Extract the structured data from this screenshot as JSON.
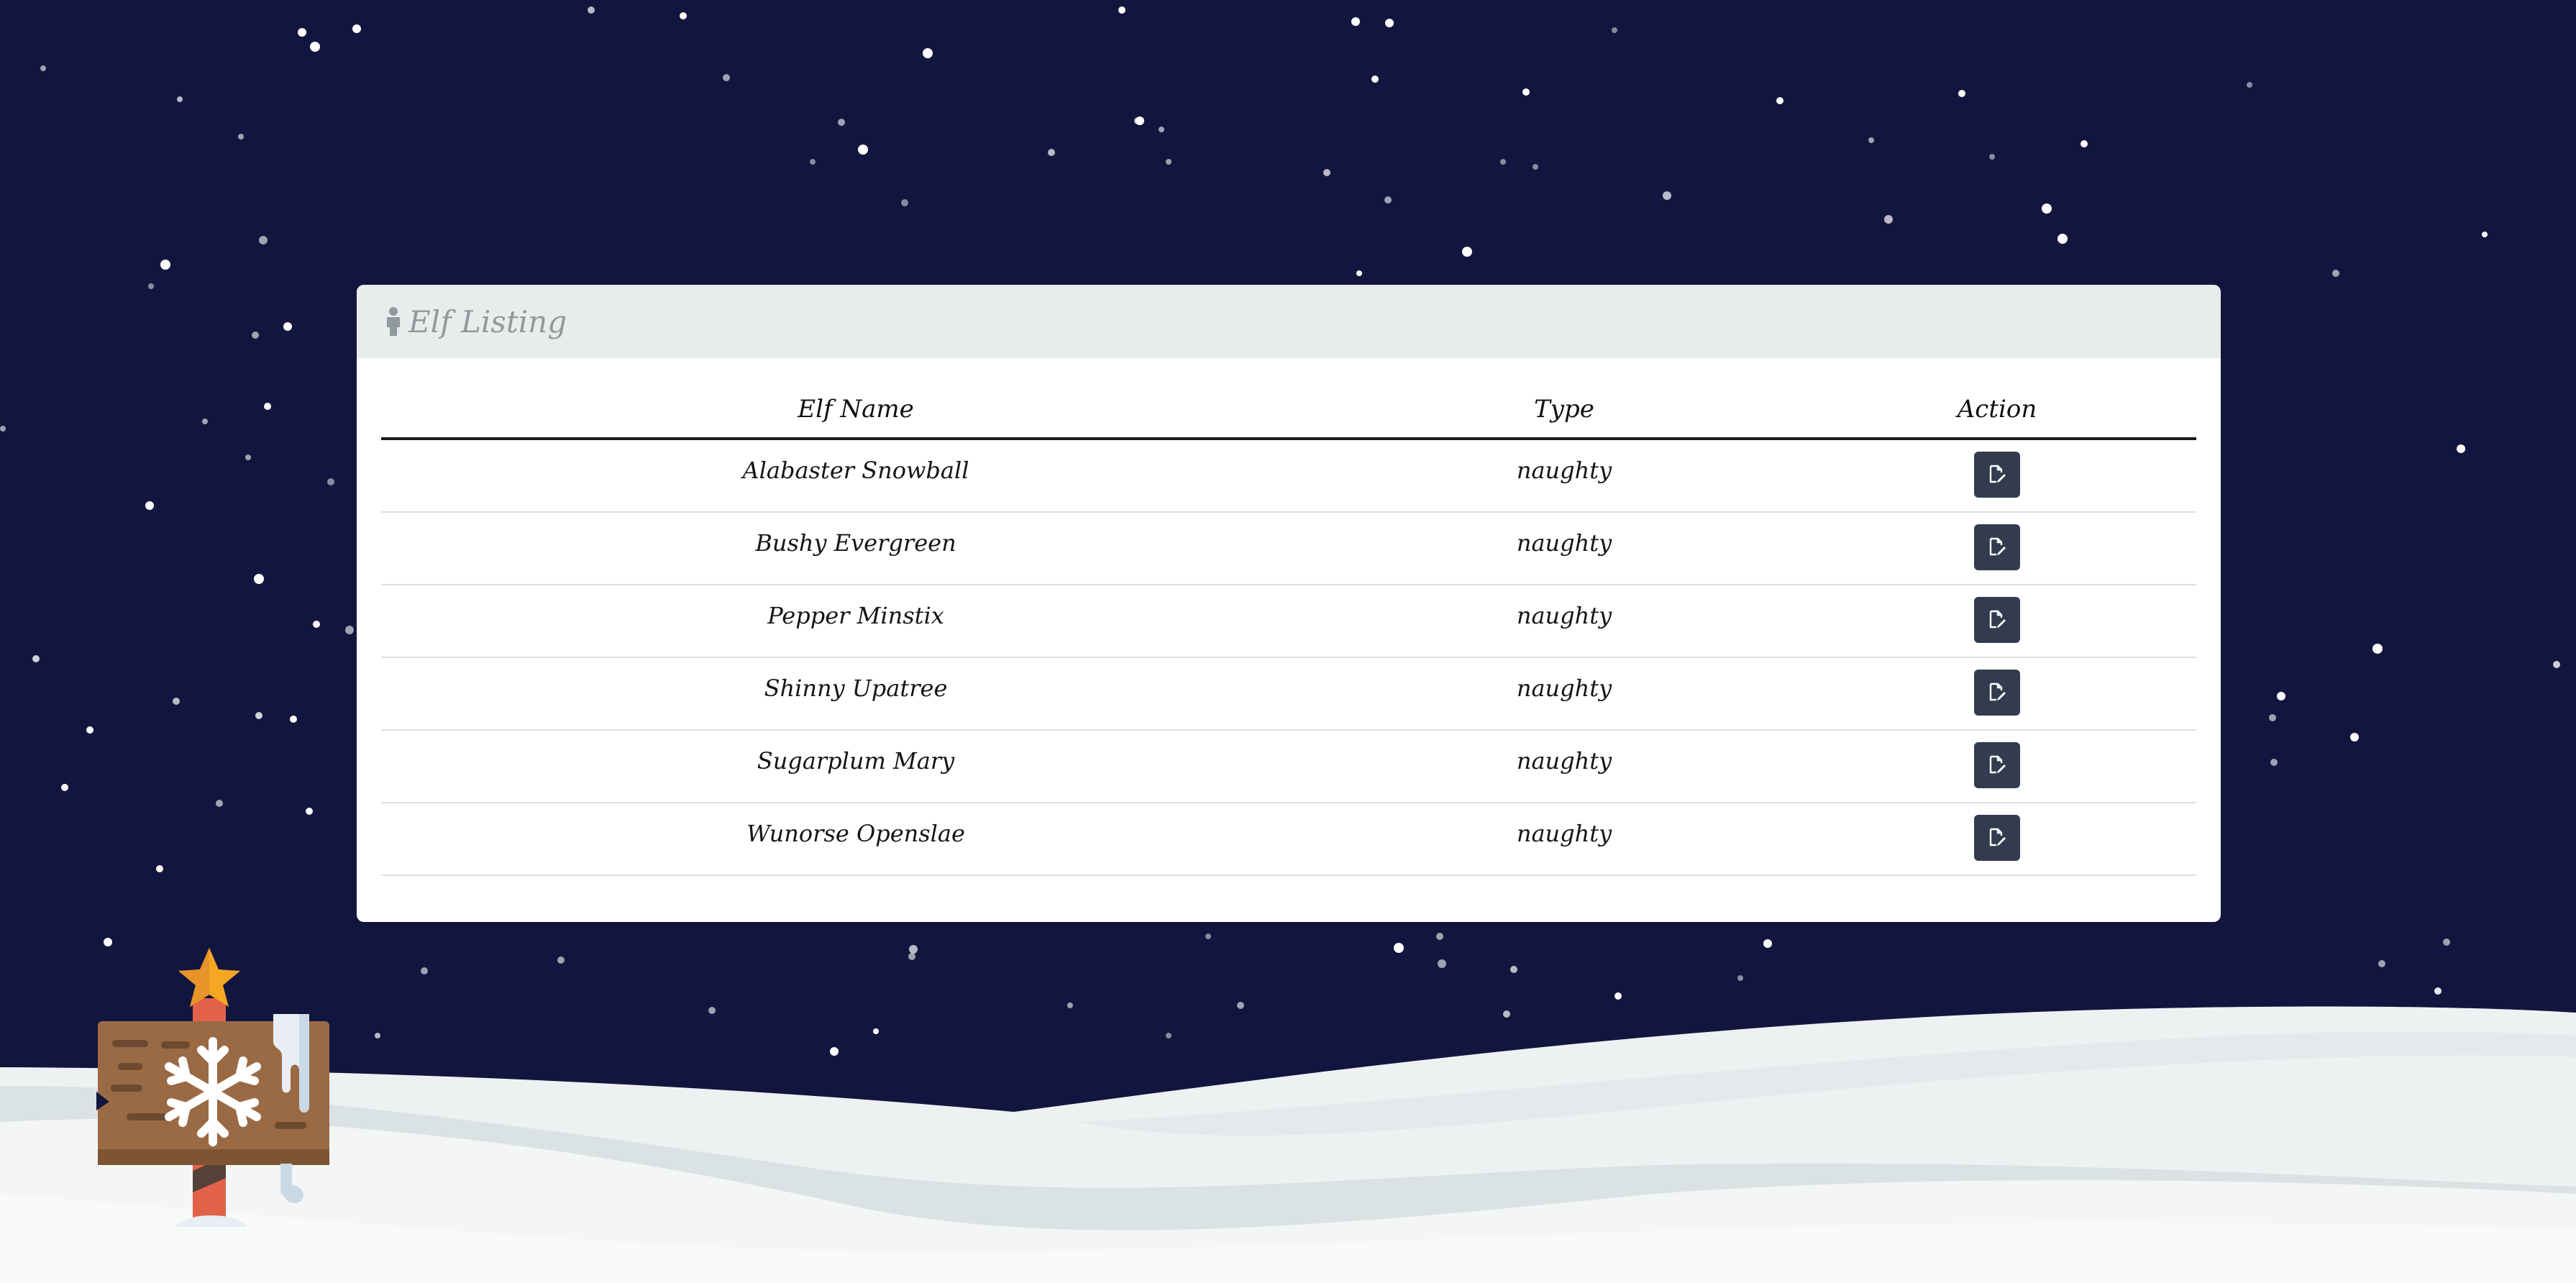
{
  "panel": {
    "title": "Elf Listing",
    "title_icon": "person-icon"
  },
  "table": {
    "columns": [
      "Elf Name",
      "Type",
      "Action"
    ],
    "rows": [
      {
        "name": "Alabaster Snowball",
        "type": "naughty",
        "action_icon": "edit-icon"
      },
      {
        "name": "Bushy Evergreen",
        "type": "naughty",
        "action_icon": "edit-icon"
      },
      {
        "name": "Pepper Minstix",
        "type": "naughty",
        "action_icon": "edit-icon"
      },
      {
        "name": "Shinny Upatree",
        "type": "naughty",
        "action_icon": "edit-icon"
      },
      {
        "name": "Sugarplum Mary",
        "type": "naughty",
        "action_icon": "edit-icon"
      },
      {
        "name": "Wunorse Openslae",
        "type": "naughty",
        "action_icon": "edit-icon"
      }
    ]
  },
  "colors": {
    "sky": "#12163f",
    "panel_header": "#e9ecec",
    "title_text": "#8f9a9a",
    "action_button": "#323c4e",
    "snow": "#f4f6f6"
  }
}
